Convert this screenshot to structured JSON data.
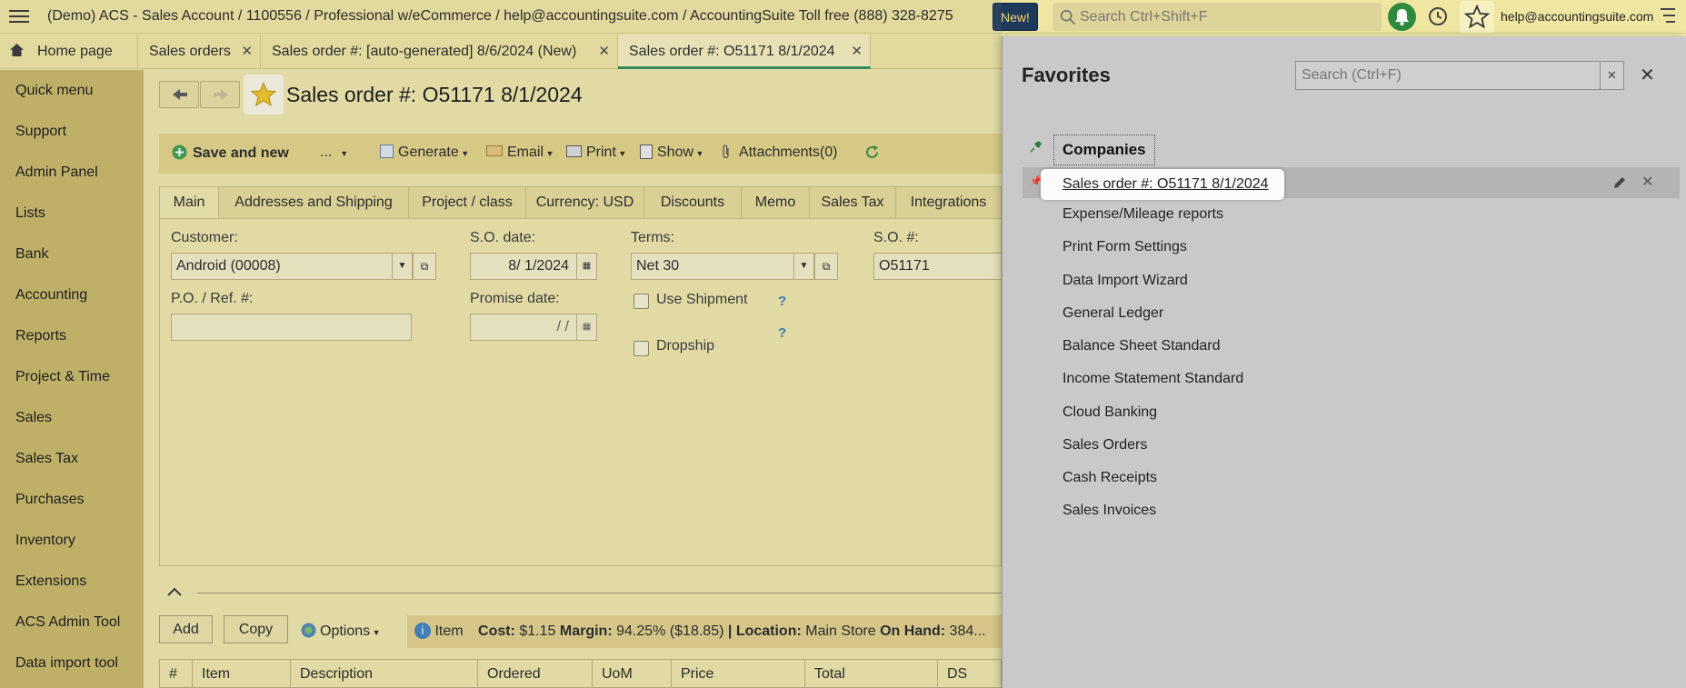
{
  "topbar": {
    "title": "(Demo) ACS - Sales Account / 1100556 / Professional w/eCommerce / help@accountingsuite.com / AccountingSuite Toll free (888) 328-8275",
    "new_badge": "New!",
    "search_placeholder": "Search Ctrl+Shift+F",
    "user_email": "help@accountingsuite.com"
  },
  "tabs": [
    {
      "label": "Home page"
    },
    {
      "label": "Sales orders"
    },
    {
      "label": "Sales order #: [auto-generated] 8/6/2024 (New)"
    },
    {
      "label": "Sales order #: O51171 8/1/2024"
    }
  ],
  "sidebar": {
    "items": [
      {
        "label": "Quick menu"
      },
      {
        "label": "Support"
      },
      {
        "label": "Admin Panel"
      },
      {
        "label": "Lists"
      },
      {
        "label": "Bank"
      },
      {
        "label": "Accounting"
      },
      {
        "label": "Reports"
      },
      {
        "label": "Project & Time"
      },
      {
        "label": "Sales"
      },
      {
        "label": "Sales Tax"
      },
      {
        "label": "Purchases"
      },
      {
        "label": "Inventory"
      },
      {
        "label": "Extensions"
      },
      {
        "label": "ACS Admin Tool"
      },
      {
        "label": "Data import tool"
      }
    ]
  },
  "document": {
    "title": "Sales order #: O51171 8/1/2024"
  },
  "toolbar": {
    "save_and_new": "Save and new",
    "more": "...",
    "generate": "Generate",
    "email": "Email",
    "print": "Print",
    "show": "Show",
    "attachments": "Attachments(0)"
  },
  "subtabs": [
    {
      "label": "Main"
    },
    {
      "label": "Addresses and Shipping"
    },
    {
      "label": "Project / class"
    },
    {
      "label": "Currency: USD"
    },
    {
      "label": "Discounts"
    },
    {
      "label": "Memo"
    },
    {
      "label": "Sales Tax"
    },
    {
      "label": "Integrations"
    }
  ],
  "form": {
    "customer_label": "Customer:",
    "customer_value": "Android (00008)",
    "so_date_label": "S.O. date:",
    "so_date_value": "8/ 1/2024",
    "terms_label": "Terms:",
    "terms_value": "Net 30",
    "so_num_label": "S.O. #:",
    "so_num_value": "O51171",
    "po_label": "P.O. / Ref. #:",
    "po_value": "",
    "promise_label": "Promise date:",
    "promise_value": " /  /",
    "use_shipment_label": "Use Shipment",
    "dropship_label": "Dropship"
  },
  "lines": {
    "add": "Add",
    "copy": "Copy",
    "options": "Options",
    "info_item": "Item",
    "info_cost_label": "Cost:",
    "info_cost": "$1.15",
    "info_margin_label": "Margin:",
    "info_margin": "94.25% ($18.85)",
    "info_sep": "|",
    "info_location_label": "Location:",
    "info_location": "Main Store",
    "info_onhand_label": "On Hand:",
    "info_onhand": "384...",
    "columns": [
      "#",
      "Item",
      "Description",
      "Ordered",
      "UoM",
      "Price",
      "Total",
      "DS"
    ]
  },
  "favorites": {
    "title": "Favorites",
    "search_placeholder": "Search (Ctrl+F)",
    "group": "Companies",
    "items": [
      {
        "label": "Sales order #: O51171 8/1/2024"
      },
      {
        "label": "Expense/Mileage reports"
      },
      {
        "label": "Print Form Settings"
      },
      {
        "label": "Data Import Wizard"
      },
      {
        "label": "General Ledger"
      },
      {
        "label": "Balance Sheet Standard"
      },
      {
        "label": "Income Statement Standard"
      },
      {
        "label": "Cloud Banking"
      },
      {
        "label": "Sales Orders"
      },
      {
        "label": "Cash Receipts"
      },
      {
        "label": "Sales Invoices"
      }
    ]
  },
  "colors": {
    "accent_green": "#2d8a5a",
    "sidebar_bg": "#c9b866",
    "topbar_bg": "#efe6a2",
    "panel_bg": "#c9c9c9",
    "new_badge_bg": "#1e3a5a"
  }
}
